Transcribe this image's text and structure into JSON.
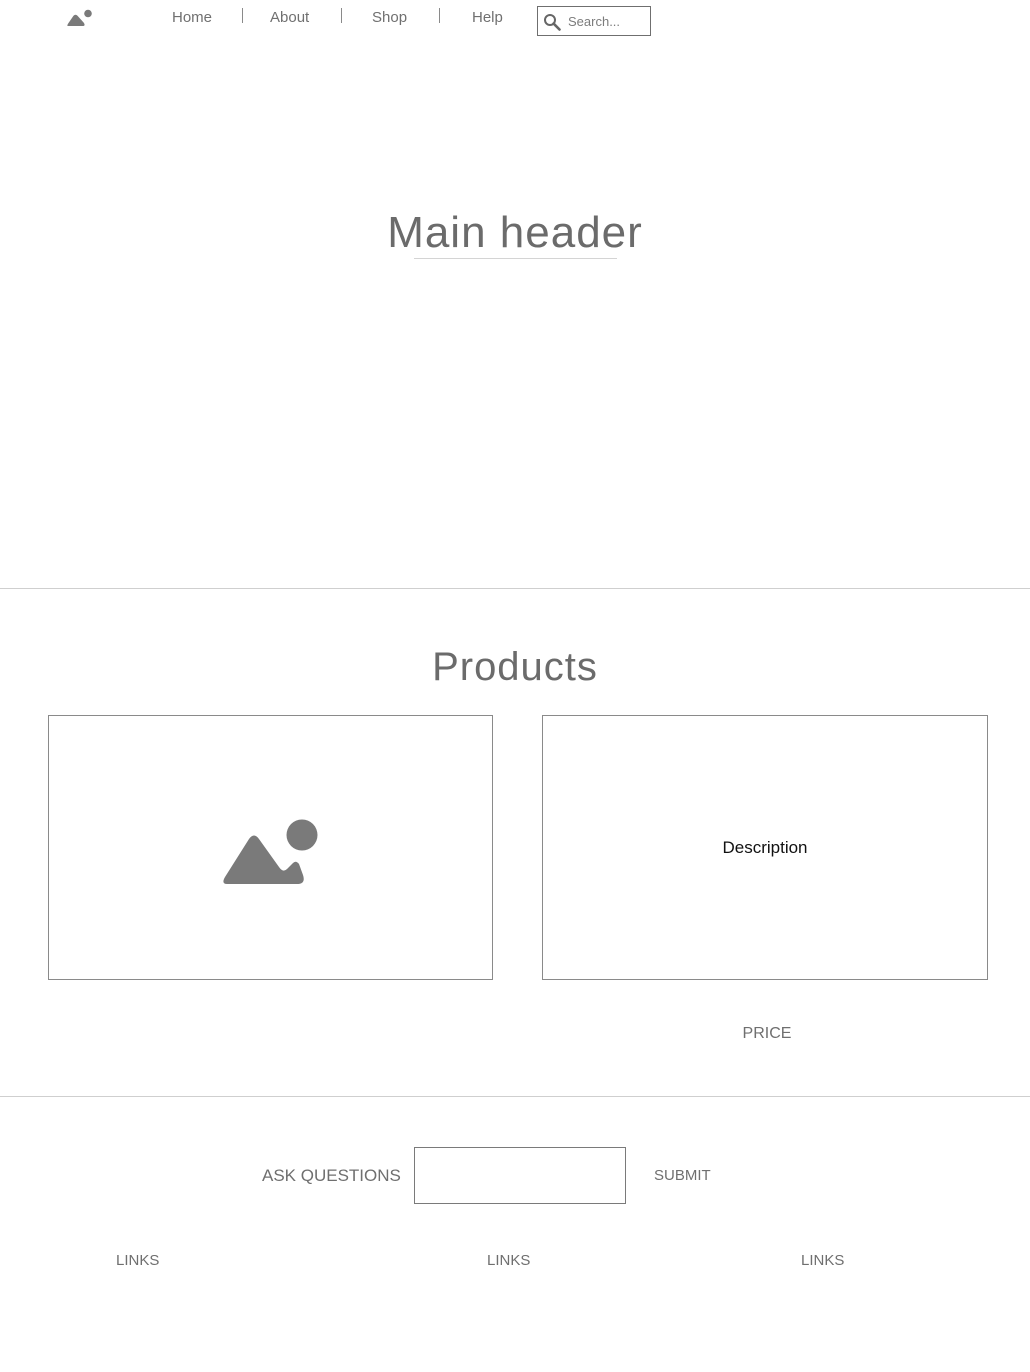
{
  "nav": {
    "logo_icon": "mountain-image-icon",
    "links": [
      "Home",
      "About",
      "Shop",
      "Help"
    ],
    "search": {
      "placeholder": "Search...",
      "icon": "search-icon"
    }
  },
  "hero": {
    "title": "Main header"
  },
  "products": {
    "title": "Products",
    "image_icon": "mountain-image-icon",
    "description": "Description",
    "price": "PRICE"
  },
  "footer": {
    "ask_label": "ASK QUESTIONS",
    "ask_value": "",
    "submit_label": "SUBMIT",
    "links": [
      "LINKS",
      "LINKS",
      "LINKS"
    ]
  },
  "colors": {
    "text": "#6b6b6b",
    "border": "#8a8a8a",
    "divider": "#cfcfcf",
    "icon": "#7a7a7a"
  }
}
